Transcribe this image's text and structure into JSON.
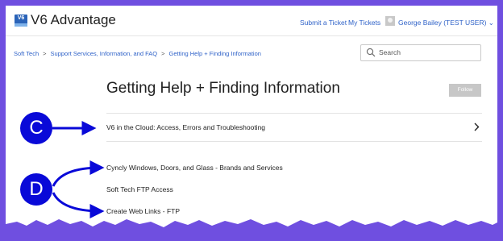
{
  "header": {
    "logo_badge": "V6",
    "app_name": "V6 Advantage",
    "submit_ticket": "Submit a Ticket",
    "my_tickets": "My Tickets",
    "user_menu": "George Bailey (TEST USER) ⌄"
  },
  "breadcrumb": {
    "items": [
      "Soft Tech",
      "Support Services, Information, and FAQ",
      "Getting Help + Finding Information"
    ],
    "separator": ">"
  },
  "search": {
    "placeholder": "Search"
  },
  "page": {
    "title": "Getting Help + Finding Information",
    "follow_label": "Follow"
  },
  "section": {
    "label": "V6 in the Cloud: Access, Errors and Troubleshooting"
  },
  "articles": [
    "Cyncly Windows, Doors, and Glass - Brands and Services",
    "Soft Tech FTP Access",
    "Create Web Links - FTP"
  ],
  "annotations": {
    "marker_c": "C",
    "marker_d": "D"
  },
  "colors": {
    "link": "#2f62c8",
    "annotation": "#0909d8",
    "border": "#6f4fe0",
    "follow_disabled": "#c7c7c7"
  },
  "icons": [
    "search-icon",
    "chevron-right-icon",
    "avatar-icon",
    "arrow-icon"
  ]
}
